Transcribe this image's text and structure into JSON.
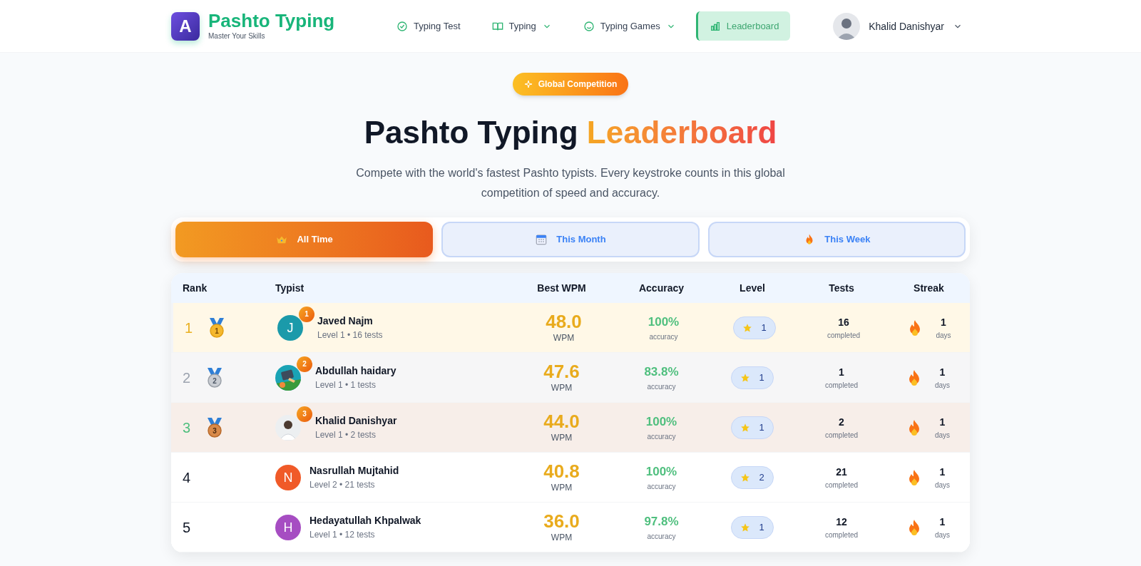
{
  "brand": {
    "logo_letter": "A",
    "name": "Pashto Typing",
    "tagline": "Master Your Skills"
  },
  "nav": [
    {
      "label": "Typing Test",
      "kind": "check",
      "dropdown": false,
      "selected": false
    },
    {
      "label": "Typing",
      "kind": "book",
      "dropdown": true,
      "selected": false
    },
    {
      "label": "Typing Games",
      "kind": "smile",
      "dropdown": true,
      "selected": false
    },
    {
      "label": "Leaderboard",
      "kind": "chart",
      "dropdown": false,
      "selected": true
    }
  ],
  "user": {
    "name": "Khalid Danishyar"
  },
  "hero": {
    "badge": "Global Competition",
    "title": "Pashto Typing",
    "title_highlight": "Leaderboard",
    "subtitle": "Compete with the world's fastest Pashto typists. Every keystroke counts in this global competition of speed and accuracy."
  },
  "filters": [
    {
      "label": "All Time",
      "kind": "crown",
      "selected": true
    },
    {
      "label": "This Month",
      "kind": "calendar",
      "selected": false
    },
    {
      "label": "This Week",
      "kind": "fire",
      "selected": false
    }
  ],
  "table": {
    "columns": [
      "Rank",
      "Typist",
      "Best WPM",
      "Accuracy",
      "Level",
      "Tests",
      "Streak"
    ],
    "rows": [
      {
        "rank": "1",
        "kind": "gold",
        "medal_number": "1",
        "avatar": {
          "kind": "letter",
          "letter": "J",
          "color": "#1b9aaa"
        },
        "rank_badge": "1",
        "name": "Javed Najm",
        "detail": "Level 1 • 16 tests",
        "wpm": "48.0",
        "wpm_unit": "WPM",
        "accuracy": "100%",
        "accuracy_label": "accuracy",
        "level": "1",
        "tests": "16",
        "tests_label": "completed",
        "streak": "1",
        "streak_label": "days"
      },
      {
        "rank": "2",
        "kind": "silver",
        "medal_number": "2",
        "rank_badge": "2",
        "name": "Abdullah haidary",
        "detail": "Level 1 • 1 tests",
        "wpm": "47.6",
        "wpm_unit": "WPM",
        "accuracy": "83.8%",
        "accuracy_label": "accuracy",
        "level": "1",
        "tests": "1",
        "tests_label": "completed",
        "streak": "1",
        "streak_label": "days"
      },
      {
        "rank": "3",
        "kind": "bronze",
        "medal_number": "3",
        "avatar": {
          "kind": "person"
        },
        "rank_badge": "3",
        "name": "Khalid Danishyar",
        "detail": "Level 1 • 2 tests",
        "wpm": "44.0",
        "wpm_unit": "WPM",
        "accuracy": "100%",
        "accuracy_label": "accuracy",
        "level": "1",
        "tests": "2",
        "tests_label": "completed",
        "streak": "1",
        "streak_label": "days"
      },
      {
        "rank": "4",
        "kind": "plain",
        "avatar": {
          "kind": "letter",
          "letter": "N",
          "color": "#f05a28"
        },
        "name": "Nasrullah Mujtahid",
        "detail": "Level 2 • 21 tests",
        "wpm": "40.8",
        "wpm_unit": "WPM",
        "accuracy": "100%",
        "accuracy_label": "accuracy",
        "level": "2",
        "tests": "21",
        "tests_label": "completed",
        "streak": "1",
        "streak_label": "days"
      },
      {
        "rank": "5",
        "kind": "plain",
        "avatar": {
          "kind": "letter",
          "letter": "H",
          "color": "#a64dc2"
        },
        "name": "Hedayatullah Khpalwak",
        "detail": "Level 1 • 12 tests",
        "wpm": "36.0",
        "wpm_unit": "WPM",
        "accuracy": "97.8%",
        "accuracy_label": "accuracy",
        "level": "1",
        "tests": "12",
        "tests_label": "completed",
        "streak": "1",
        "streak_label": "days"
      }
    ]
  }
}
